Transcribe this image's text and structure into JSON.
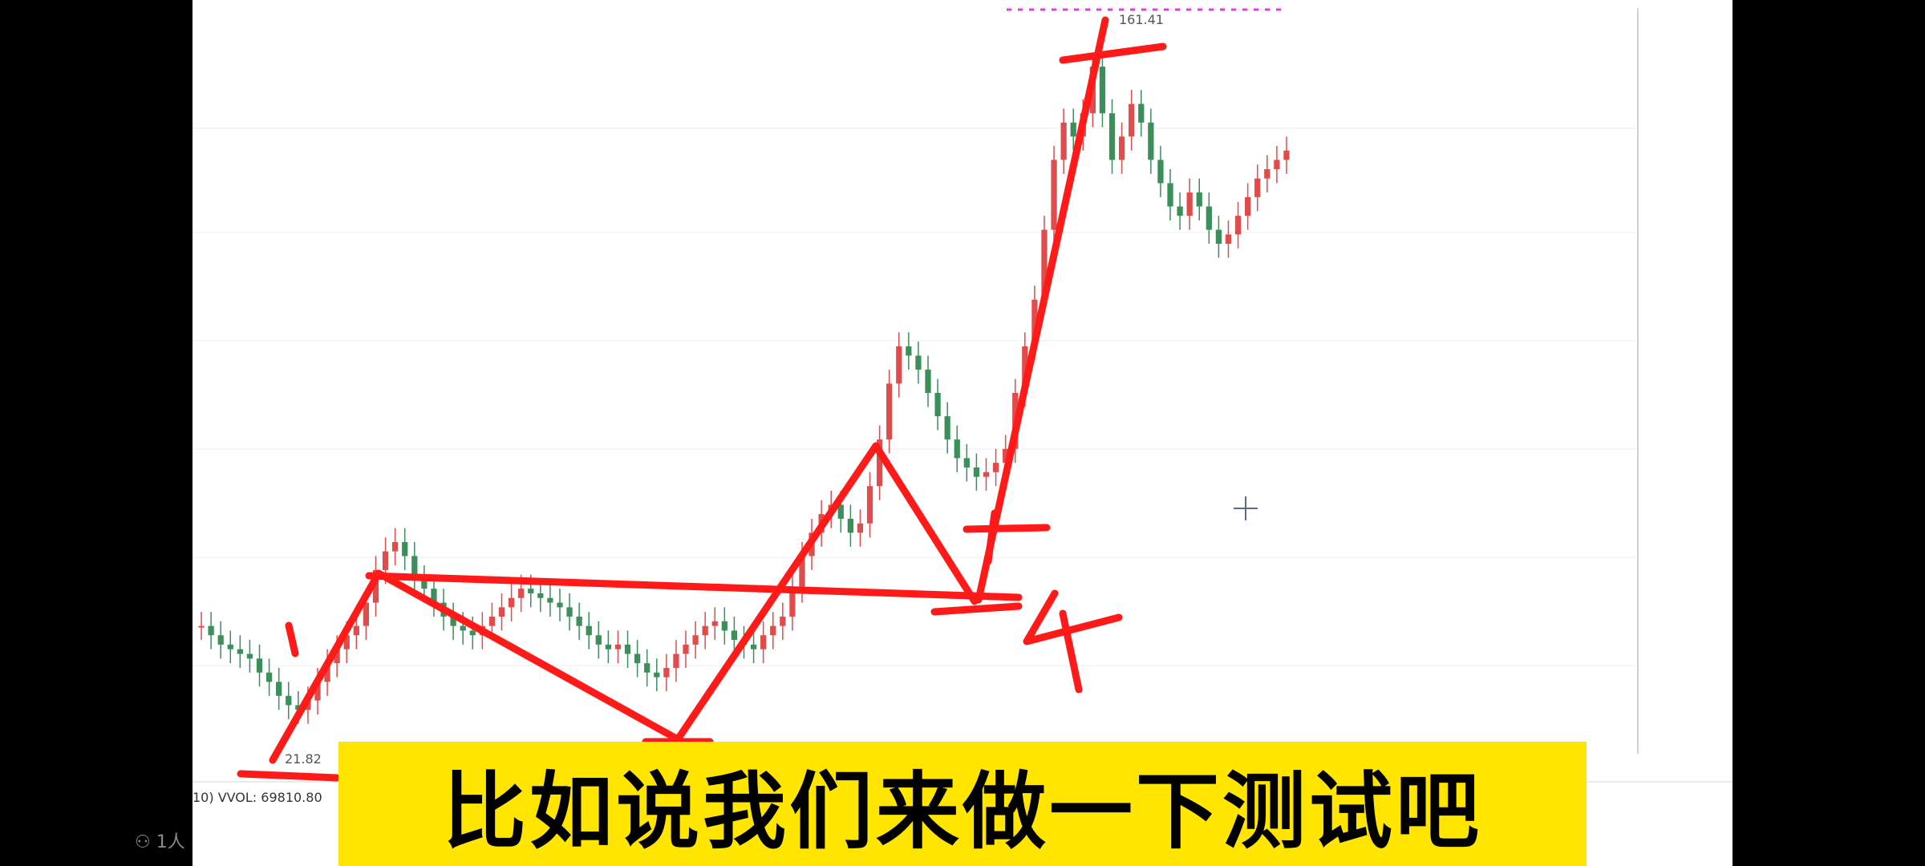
{
  "colors": {
    "background": "#000000",
    "chart_bg": "#FFFFFF",
    "gridline": "#E9EDF1",
    "up_candle": "#E04B4B",
    "down_candle": "#3A8F5A",
    "annotation": "#FF1A1A",
    "caption_bg": "#FFE500",
    "caption_text": "#000000",
    "crosshair": "#5A6A8A",
    "label_text": "#555555"
  },
  "caption": {
    "text": "比如说我们来做一下测试吧"
  },
  "overlay": {
    "viewer_icon": "people-icon",
    "viewer_text": "1人"
  },
  "chart_data": {
    "type": "candlestick",
    "low_label": "21.82",
    "high_label": "161.41",
    "indicator_label": "10) VVOL: 69810.80",
    "annotations": [
      "1",
      "4"
    ],
    "series": [
      {
        "name": "",
        "values": [
          40,
          38,
          36,
          35,
          34,
          33,
          30,
          28,
          25,
          23,
          22,
          24,
          28,
          32,
          35,
          38,
          40,
          45,
          52,
          56,
          58,
          55,
          50,
          48,
          45,
          42,
          40,
          39,
          38,
          40,
          42,
          44,
          46,
          48,
          47,
          46,
          45,
          44,
          42,
          40,
          38,
          36,
          35,
          36,
          34,
          32,
          30,
          29,
          31,
          34,
          36,
          38,
          40,
          41,
          39,
          37,
          36,
          35,
          38,
          40,
          42,
          48,
          55,
          60,
          64,
          66,
          63,
          60,
          62,
          70,
          80,
          92,
          100,
          98,
          95,
          90,
          85,
          80,
          76,
          74,
          72,
          73,
          75,
          78,
          90,
          100,
          110,
          125,
          140,
          148,
          145,
          150,
          160,
          150,
          140,
          145,
          152,
          148,
          140,
          135,
          130,
          128,
          133,
          130,
          125,
          122,
          124,
          128,
          132,
          136,
          138,
          140,
          142
        ]
      }
    ],
    "ylim": [
      10,
      170
    ],
    "grid": true
  }
}
